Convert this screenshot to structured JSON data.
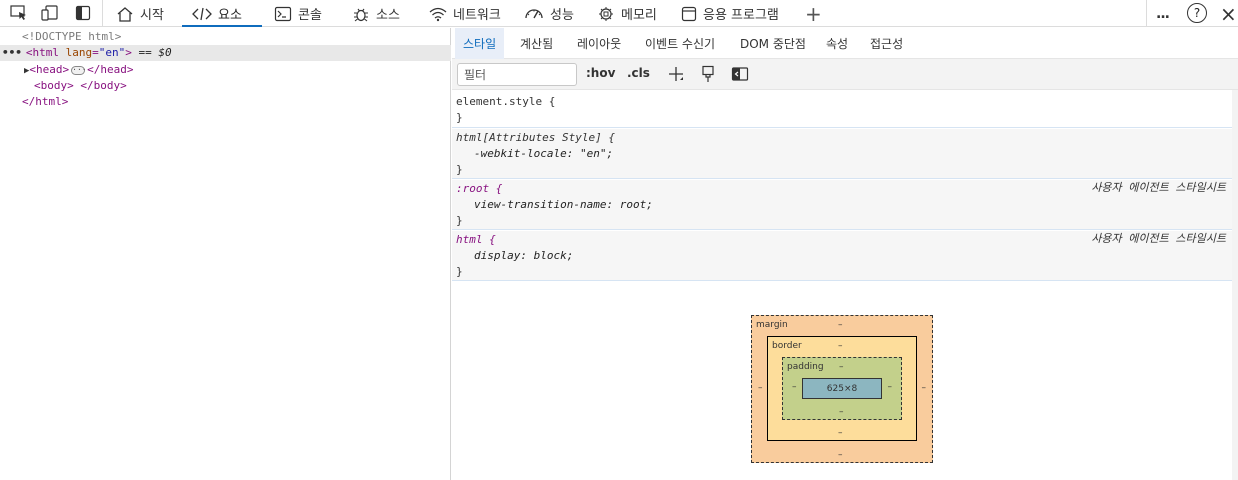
{
  "toolbar": {
    "tabs": [
      {
        "label": "시작",
        "icon": "home-icon"
      },
      {
        "label": "요소",
        "icon": "code-icon"
      },
      {
        "label": "콘솔",
        "icon": "console-icon"
      },
      {
        "label": "소스",
        "icon": "bug-icon"
      },
      {
        "label": "네트워크",
        "icon": "wifi-icon"
      },
      {
        "label": "성능",
        "icon": "gauge-icon"
      },
      {
        "label": "메모리",
        "icon": "chip-icon"
      },
      {
        "label": "응용 프로그램",
        "icon": "app-window-icon"
      }
    ],
    "active_tab": "요소",
    "add_tab": "+",
    "more": "...",
    "help": "?",
    "close": "×"
  },
  "dom_tree": {
    "doctype": "<!DOCTYPE html>",
    "ellipsis": "•••",
    "html_open": "<html",
    "html_attr_name": "lang",
    "html_attr_eq": "=",
    "html_attr_value": "\"en\"",
    "html_close_bracket": ">",
    "selected_marker": "== $0",
    "head_open": "<head>",
    "head_close": "</head>",
    "body_open": "<body>",
    "body_close": "</body>",
    "html_close": "</html>"
  },
  "styles": {
    "subtabs": [
      "스타일",
      "계산됨",
      "레이아웃",
      "이벤트 수신기",
      "DOM 중단점",
      "속성",
      "접근성"
    ],
    "filter_placeholder": "필터",
    "hov": ":hov",
    "cls": ".cls",
    "rules": [
      {
        "selector": "element.style {",
        "close": "}"
      },
      {
        "selector": "html[Attributes Style] {",
        "prop": "-webkit-locale",
        "colon": ":",
        "value": "\"en\";",
        "close": "}"
      },
      {
        "selector": ":root {",
        "prop": "view-transition-name",
        "colon": ":",
        "value": "root;",
        "close": "}",
        "origin": "사용자 에이전트 스타일시트"
      },
      {
        "selector": "html {",
        "prop": "display",
        "colon": ":",
        "value": "block;",
        "close": "}",
        "origin": "사용자 에이전트 스타일시트"
      }
    ]
  },
  "box_model": {
    "margin_label": "margin",
    "border_label": "border",
    "padding_label": "padding",
    "content_size": "625×8",
    "dash": "–"
  },
  "colors": {
    "accent": "#0f6cbd",
    "margin": "#f9cc9d",
    "border": "#fddd9b",
    "padding": "#c3d08b",
    "content": "#8cb6c0"
  }
}
